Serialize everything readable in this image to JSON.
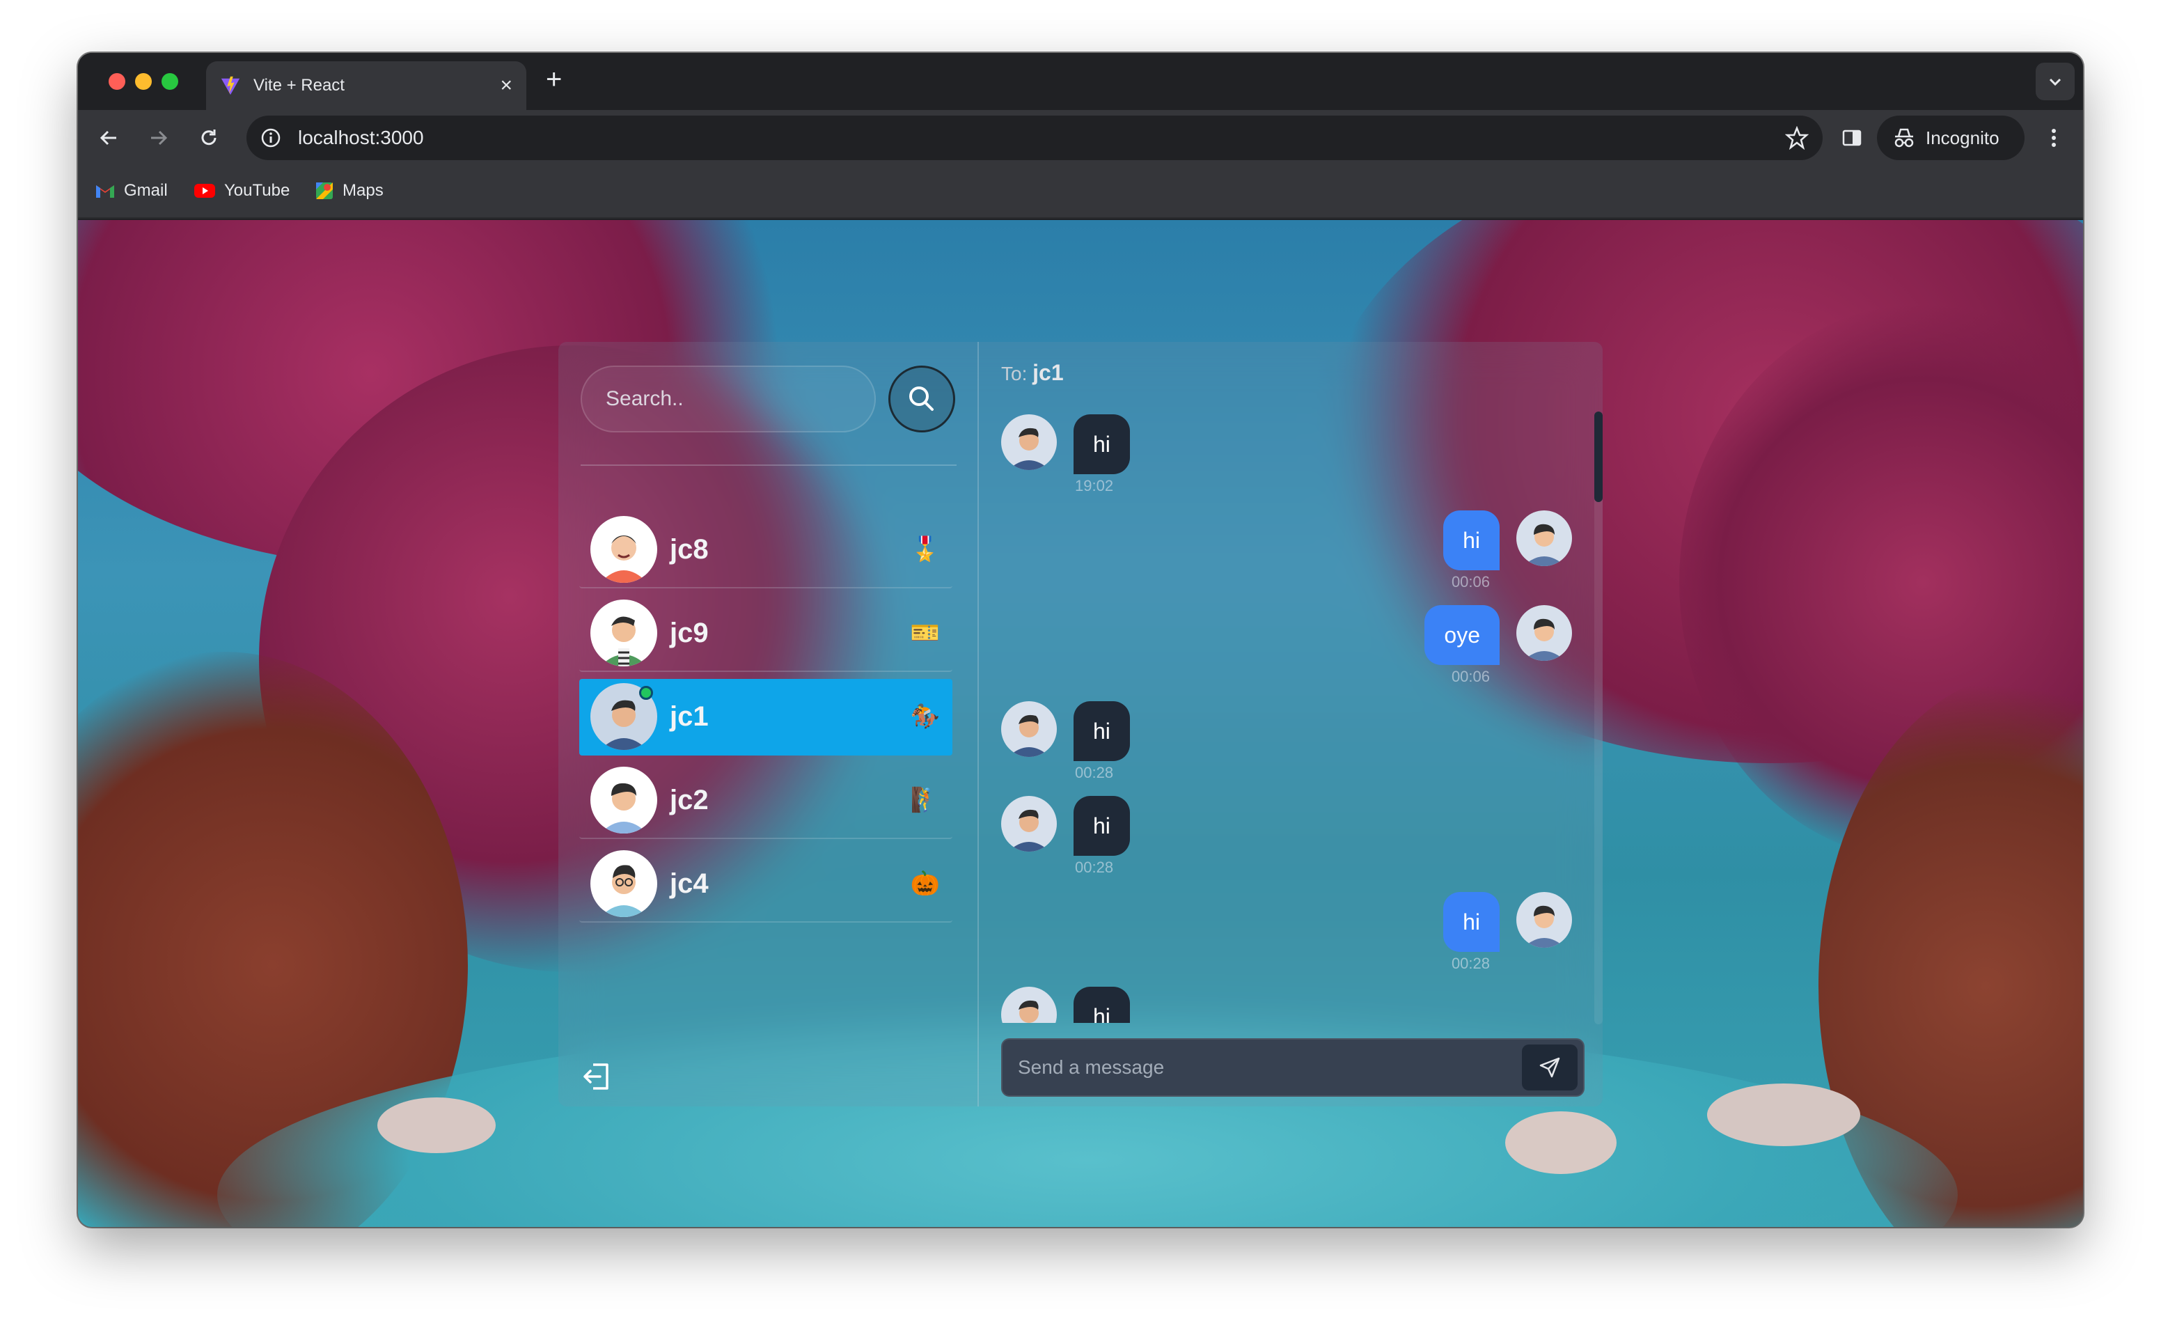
{
  "browser": {
    "tab_title": "Vite + React",
    "url": "localhost:3000",
    "profile_label": "Incognito",
    "bookmarks": [
      {
        "label": "Gmail",
        "icon": "gmail-icon"
      },
      {
        "label": "YouTube",
        "icon": "youtube-icon"
      },
      {
        "label": "Maps",
        "icon": "maps-icon"
      }
    ]
  },
  "sidebar": {
    "search_placeholder": "Search..",
    "conversations": [
      {
        "name": "jc8",
        "emoji": "🎖️",
        "active": false,
        "online": false
      },
      {
        "name": "jc9",
        "emoji": "🎫",
        "active": false,
        "online": false
      },
      {
        "name": "jc1",
        "emoji": "🏇",
        "active": true,
        "online": true
      },
      {
        "name": "jc2",
        "emoji": "🧗",
        "active": false,
        "online": false
      },
      {
        "name": "jc4",
        "emoji": "🎃",
        "active": false,
        "online": false
      }
    ]
  },
  "chat": {
    "to_label": "To:",
    "recipient": "jc1",
    "messages": [
      {
        "from": "them",
        "text": "hi",
        "time": "19:02"
      },
      {
        "from": "me",
        "text": "hi",
        "time": "00:06"
      },
      {
        "from": "me",
        "text": "oye",
        "time": "00:06"
      },
      {
        "from": "them",
        "text": "hi",
        "time": "00:28"
      },
      {
        "from": "them",
        "text": "hi",
        "time": "00:28"
      },
      {
        "from": "me",
        "text": "hi",
        "time": "00:28"
      },
      {
        "from": "them",
        "text": "hi",
        "time": ""
      }
    ],
    "composer_placeholder": "Send a message"
  },
  "colors": {
    "active_conversation": "#0ea5e9",
    "sent_bubble": "#3b82f6",
    "received_bubble": "#1f2937",
    "online_dot": "#22c55e"
  }
}
